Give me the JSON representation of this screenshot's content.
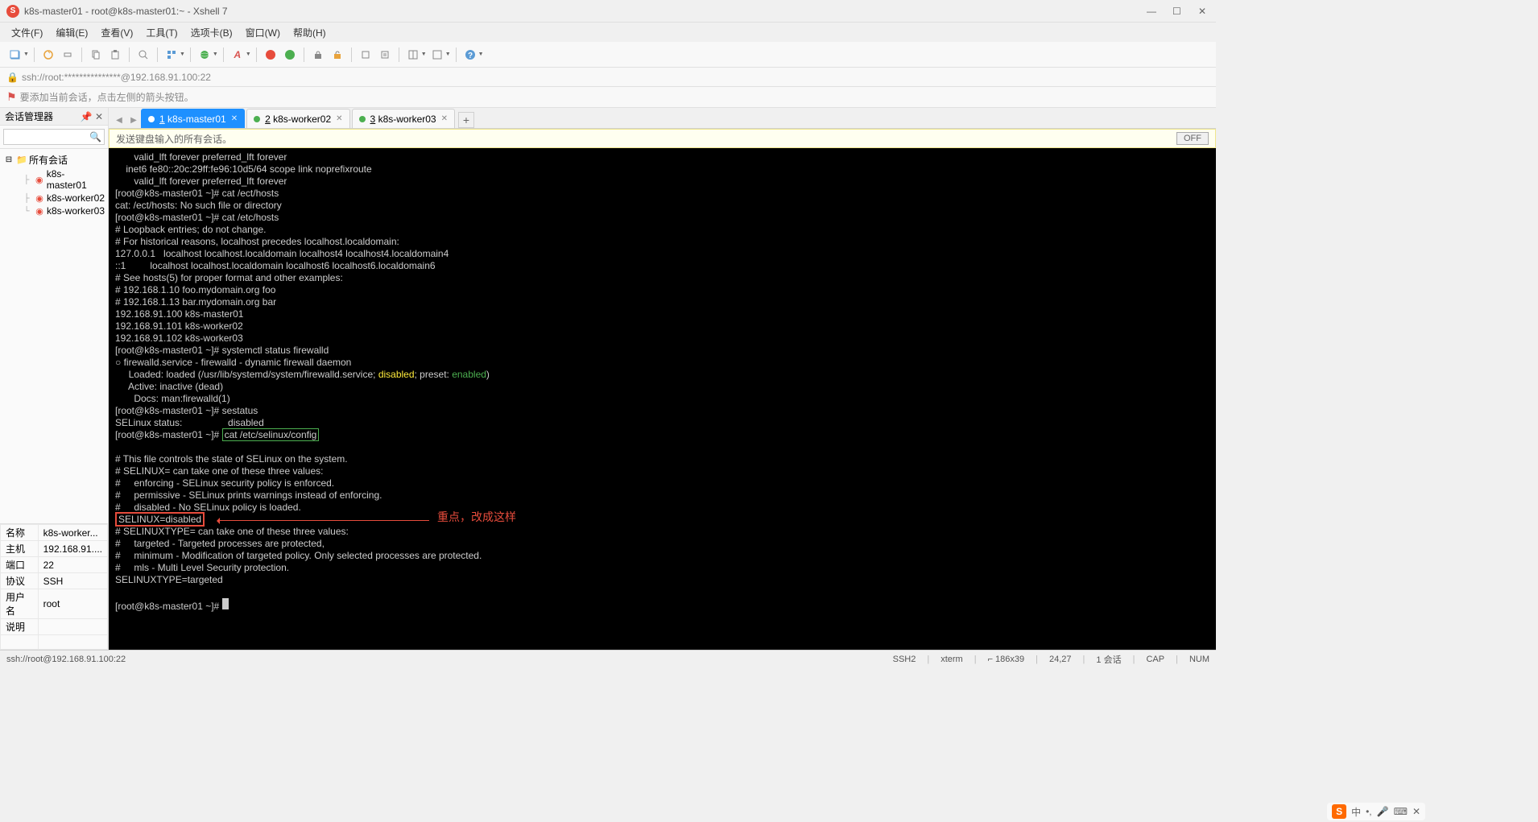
{
  "window": {
    "title": "k8s-master01 - root@k8s-master01:~ - Xshell 7",
    "address": "ssh://root:***************@192.168.91.100:22",
    "hint": "要添加当前会话，点击左侧的箭头按钮。"
  },
  "menu": {
    "items": [
      "文件(F)",
      "编辑(E)",
      "查看(V)",
      "工具(T)",
      "选项卡(B)",
      "窗口(W)",
      "帮助(H)"
    ]
  },
  "sidebar": {
    "title": "会话管理器",
    "search_placeholder": "",
    "root": "所有会话",
    "sessions": [
      "k8s-master01",
      "k8s-worker02",
      "k8s-worker03"
    ]
  },
  "tabs": [
    {
      "n": "1",
      "label": "k8s-master01",
      "active": true
    },
    {
      "n": "2",
      "label": "k8s-worker02",
      "active": false
    },
    {
      "n": "3",
      "label": "k8s-worker03",
      "active": false
    }
  ],
  "infobar": {
    "text": "发送键盘输入的所有会话。",
    "off": "OFF"
  },
  "terminal_lines": [
    {
      "t": "       valid_lft forever preferred_lft forever"
    },
    {
      "t": "    inet6 fe80::20c:29ff:fe96:10d5/64 scope link noprefixroute"
    },
    {
      "t": "       valid_lft forever preferred_lft forever"
    },
    {
      "t": "[root@k8s-master01 ~]# cat /ect/hosts"
    },
    {
      "t": "cat: /ect/hosts: No such file or directory"
    },
    {
      "t": "[root@k8s-master01 ~]# cat /etc/hosts"
    },
    {
      "t": "# Loopback entries; do not change."
    },
    {
      "t": "# For historical reasons, localhost precedes localhost.localdomain:"
    },
    {
      "t": "127.0.0.1   localhost localhost.localdomain localhost4 localhost4.localdomain4"
    },
    {
      "t": "::1         localhost localhost.localdomain localhost6 localhost6.localdomain6"
    },
    {
      "t": "# See hosts(5) for proper format and other examples:"
    },
    {
      "t": "# 192.168.1.10 foo.mydomain.org foo"
    },
    {
      "t": "# 192.168.1.13 bar.mydomain.org bar"
    },
    {
      "t": "192.168.91.100 k8s-master01"
    },
    {
      "t": "192.168.91.101 k8s-worker02"
    },
    {
      "t": "192.168.91.102 k8s-worker03"
    },
    {
      "t": "[root@k8s-master01 ~]# systemctl status firewalld"
    },
    {
      "t": "○ firewalld.service - firewalld - dynamic firewall daemon"
    },
    {
      "special": "loaded",
      "pre": "     Loaded: loaded (/usr/lib/systemd/system/firewalld.service; ",
      "disabled": "disabled",
      "mid": "; preset: ",
      "enabled": "enabled",
      "post": ")"
    },
    {
      "t": "     Active: inactive (dead)"
    },
    {
      "t": "       Docs: man:firewalld(1)"
    },
    {
      "t": "[root@k8s-master01 ~]# sestatus"
    },
    {
      "t": "SELinux status:                 disabled"
    },
    {
      "special": "cmdbox",
      "prompt": "[root@k8s-master01 ~]# ",
      "cmd": "cat /etc/selinux/config"
    },
    {
      "t": ""
    },
    {
      "t": "# This file controls the state of SELinux on the system."
    },
    {
      "t": "# SELINUX= can take one of these three values:"
    },
    {
      "t": "#     enforcing - SELinux security policy is enforced."
    },
    {
      "t": "#     permissive - SELinux prints warnings instead of enforcing."
    },
    {
      "t": "#     disabled - No SELinux policy is loaded."
    },
    {
      "special": "redbox",
      "val": "SELINUX=disabled",
      "anno": "重点，改成这样"
    },
    {
      "t": "# SELINUXTYPE= can take one of these three values:"
    },
    {
      "t": "#     targeted - Targeted processes are protected,"
    },
    {
      "t": "#     minimum - Modification of targeted policy. Only selected processes are protected."
    },
    {
      "t": "#     mls - Multi Level Security protection."
    },
    {
      "t": "SELINUXTYPE=targeted"
    },
    {
      "t": ""
    },
    {
      "special": "cursor",
      "prompt": "[root@k8s-master01 ~]# "
    }
  ],
  "props": [
    {
      "k": "名称",
      "v": "k8s-worker..."
    },
    {
      "k": "主机",
      "v": "192.168.91...."
    },
    {
      "k": "端口",
      "v": "22"
    },
    {
      "k": "协议",
      "v": "SSH"
    },
    {
      "k": "用户名",
      "v": "root"
    },
    {
      "k": "说明",
      "v": ""
    }
  ],
  "status": {
    "left": "ssh://root@192.168.91.100:22",
    "right": [
      "SSH2",
      "xterm",
      "⌐ 186x39",
      "24,27",
      "1 会话",
      "CAP",
      "NUM"
    ],
    "ime": [
      "中",
      "•,",
      "🎤",
      "⌨",
      "✕"
    ]
  }
}
